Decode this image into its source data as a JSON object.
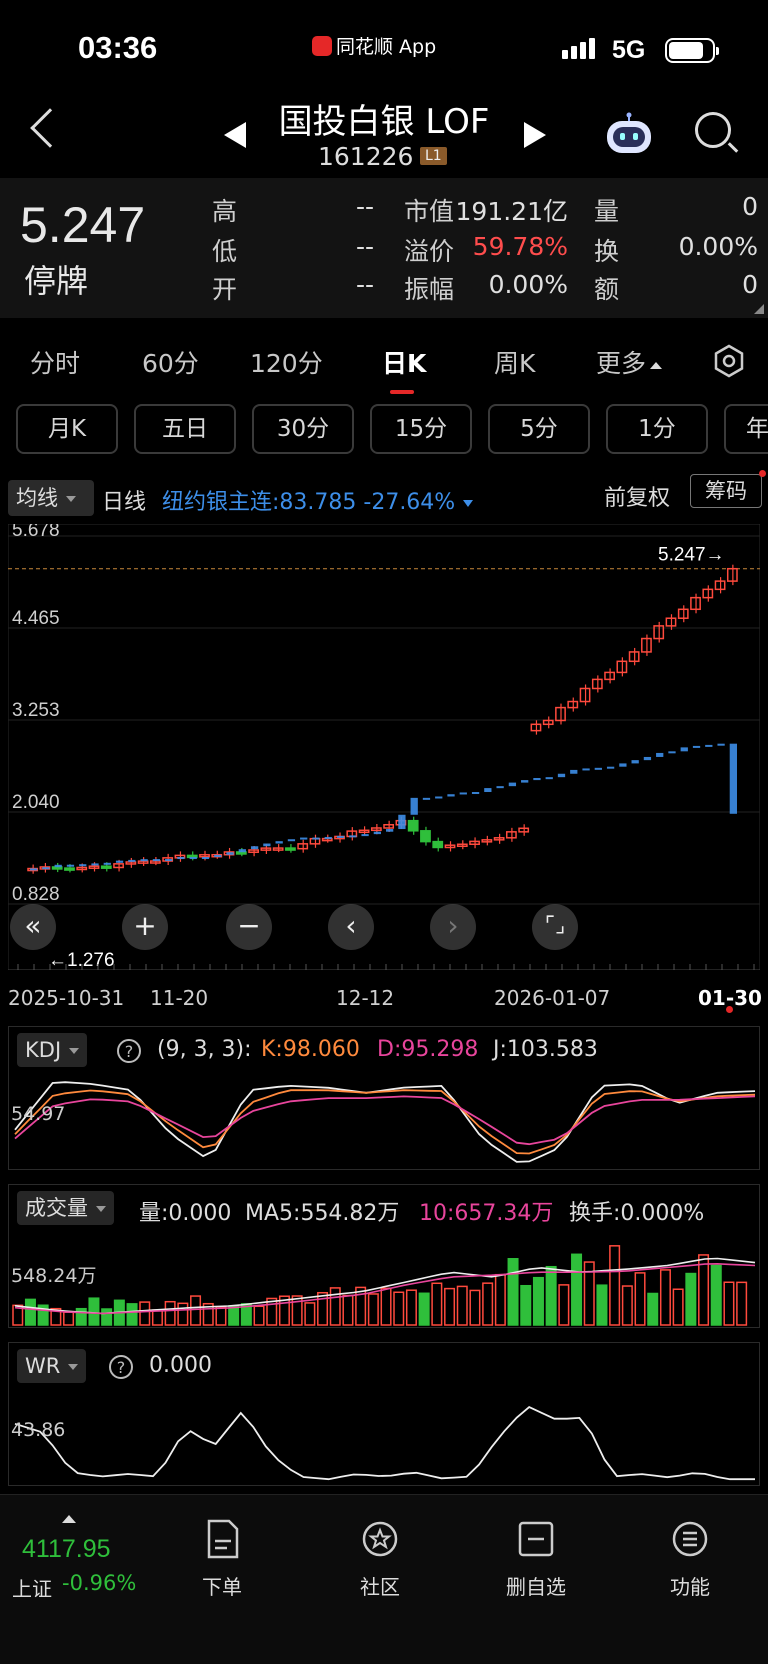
{
  "status": {
    "time": "03:36",
    "app": "同花顺 App",
    "network": "5G"
  },
  "header": {
    "name": "国投白银 LOF",
    "code": "161226",
    "level": "L1"
  },
  "quote": {
    "price": "5.247",
    "state": "停牌",
    "fields": [
      {
        "label": "高",
        "value": "--"
      },
      {
        "label": "低",
        "value": "--"
      },
      {
        "label": "开",
        "value": "--"
      }
    ],
    "mid": [
      {
        "label": "市值",
        "value": "191.21亿"
      },
      {
        "label": "溢价",
        "value": "59.78%"
      },
      {
        "label": "振幅",
        "value": "0.00%"
      }
    ],
    "right": [
      {
        "label": "量",
        "value": "0"
      },
      {
        "label": "换",
        "value": "0.00%"
      },
      {
        "label": "额",
        "value": "0"
      }
    ]
  },
  "tabs": [
    "分时",
    "60分",
    "120分",
    "日K",
    "周K",
    "更多"
  ],
  "periods": [
    "月K",
    "五日",
    "30分",
    "15分",
    "5分",
    "1分",
    "年"
  ],
  "ma_bar": {
    "select": "均线",
    "label": "日线",
    "silver": "纽约银主连:83.785  -27.64%",
    "fq": "前复权",
    "chip": "筹码"
  },
  "main": {
    "y_ticks": [
      "5.678",
      "4.465",
      "3.253",
      "2.040",
      "0.828"
    ],
    "last_label": "5.247→",
    "low_label": "←1.276",
    "dates": [
      "2025-10-31",
      "11-20",
      "12-12",
      "2026-01-07",
      "01-30"
    ]
  },
  "kdj": {
    "select": "KDJ",
    "params": "(9, 3, 3):",
    "k": "K:98.060",
    "d": "D:95.298",
    "j": "J:103.583",
    "level": "54.97"
  },
  "volume": {
    "select": "成交量",
    "vol": "量:0.000",
    "ma5": "MA5:554.82万",
    "ma10": "10:657.34万",
    "turnover": "换手:0.000%",
    "level": "548.24万"
  },
  "wr": {
    "select": "WR",
    "value": "0.000",
    "level": "43.86"
  },
  "bottom": {
    "index_value": "4117.95",
    "index_name": "上证",
    "index_change": "-0.96%",
    "nav": [
      "下单",
      "社区",
      "删自选",
      "功能"
    ]
  },
  "colors": {
    "up": "#ff4a3d",
    "down": "#2fbf3b",
    "silver": "#3d8ee8"
  },
  "chart_data": {
    "type": "candlestick",
    "ylim": [
      0.828,
      5.678
    ],
    "last_close": 5.247,
    "low": 1.276,
    "x_ticks": [
      "2025-10-31",
      "11-20",
      "12-12",
      "2026-01-07",
      "01-30"
    ]
  }
}
